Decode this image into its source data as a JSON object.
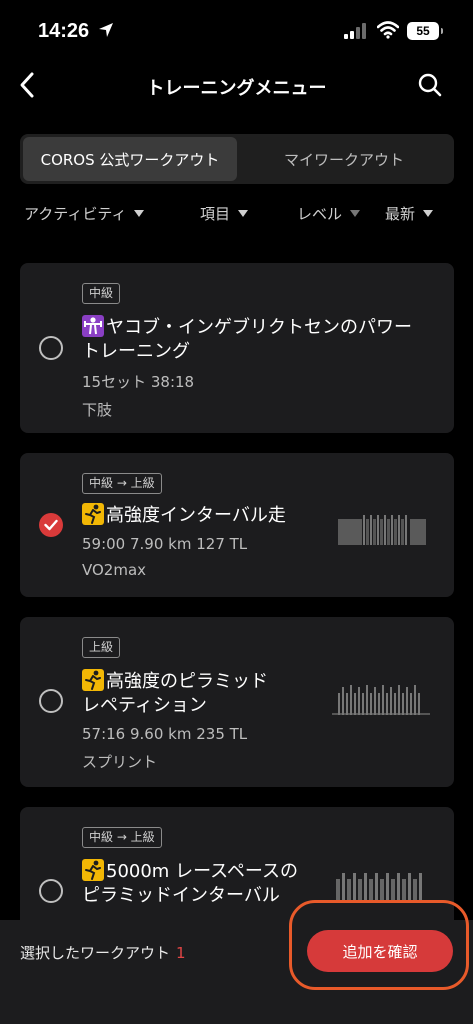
{
  "status": {
    "time": "14:26",
    "battery": "55"
  },
  "nav": {
    "title": "トレーニングメニュー"
  },
  "tabs": [
    {
      "label": "COROS 公式ワークアウト",
      "active": true
    },
    {
      "label": "マイワークアウト",
      "active": false
    }
  ],
  "filters": [
    {
      "label": "アクティビティ"
    },
    {
      "label": "項目"
    },
    {
      "label": "レベル"
    },
    {
      "label": "最新"
    }
  ],
  "workouts": [
    {
      "level": "中級",
      "icon": "strength-icon",
      "title_line1": "ヤコブ・インゲブリクトセンのパワー",
      "title_line2": "トレーニング",
      "meta": "15セット  38:18",
      "category": "下肢",
      "selected": false
    },
    {
      "level": "中級 → 上級",
      "icon": "running-icon",
      "title_line1": "高強度インターバル走",
      "title_line2": "",
      "meta": "59:00  7.90 km  127 TL",
      "category": "VO2max",
      "selected": true
    },
    {
      "level": "上級",
      "icon": "running-icon",
      "title_line1": "高強度のピラミッド",
      "title_line2": "レペティション",
      "meta": "57:16  9.60 km  235 TL",
      "category": "スプリント",
      "selected": false
    },
    {
      "level": "中級 → 上級",
      "icon": "running-icon",
      "title_line1": "5000m レースペースの",
      "title_line2": "ピラミッドインターバル",
      "meta": "",
      "category": "",
      "selected": false
    }
  ],
  "bottom": {
    "selected_label": "選択したワークアウト",
    "selected_count": "1",
    "confirm_label": "追加を確認"
  },
  "colors": {
    "accent": "#d63a3a",
    "card": "#1c1c1e",
    "highlight": "#e85a2a"
  }
}
